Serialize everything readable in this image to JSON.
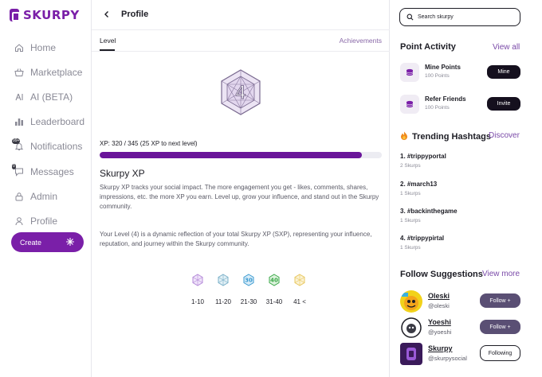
{
  "app": {
    "name": "SKURPY"
  },
  "sidebar": {
    "items": [
      {
        "label": "Home",
        "icon": "home-icon"
      },
      {
        "label": "Marketplace",
        "icon": "basket-icon"
      },
      {
        "label": "AI (BETA)",
        "icon": "ai-icon"
      },
      {
        "label": "Leaderboard",
        "icon": "bar-chart-icon"
      },
      {
        "label": "Notifications",
        "icon": "bell-icon",
        "badge": "99+"
      },
      {
        "label": "Messages",
        "icon": "chat-icon",
        "badge": "0"
      },
      {
        "label": "Admin",
        "icon": "lock-icon"
      },
      {
        "label": "Profile",
        "icon": "user-icon"
      }
    ],
    "create_label": "Create"
  },
  "header": {
    "title": "Profile"
  },
  "tabs": {
    "level": "Level",
    "achievements": "Achievements"
  },
  "level": {
    "number": "4",
    "xp_text": "XP: 320 / 345 (25 XP to next level)",
    "xp_progress_fraction": 0.928,
    "section_title": "Skurpy XP",
    "para1": "Skurpy XP tracks your social impact. The more engagement you get - likes, comments, shares, impressions, etc. the more XP you earn. Level up, grow your influence, and stand out in the Skurpy community.",
    "para2": "Your Level (4) is a dynamic reflection of your total Skurpy XP (SXP), representing your influence, reputation, and journey within the Skurpy community.",
    "tiers": [
      {
        "label": "1-10",
        "icon_text": "",
        "color": "#b48ad8"
      },
      {
        "label": "11-20",
        "icon_text": "",
        "color": "#7ab0c8"
      },
      {
        "label": "21-30",
        "icon_text": "30",
        "color": "#3a9ad0"
      },
      {
        "label": "31-40",
        "icon_text": "40",
        "color": "#3aa848"
      },
      {
        "label": "41 <",
        "icon_text": "",
        "color": "#e8c860"
      }
    ]
  },
  "right": {
    "search_placeholder": "Search skurpy",
    "point_activity": {
      "title": "Point Activity",
      "view_all": "View all",
      "items": [
        {
          "title": "Mine Points",
          "sub": "100 Points",
          "button": "Mine"
        },
        {
          "title": "Refer Friends",
          "sub": "100 Points",
          "button": "Invite"
        }
      ]
    },
    "trending": {
      "title": "Trending Hashtags",
      "link": "Discover",
      "items": [
        {
          "tag": "1. #trippyportal",
          "count": "2 Skurps"
        },
        {
          "tag": "2. #march13",
          "count": "1 Skurps"
        },
        {
          "tag": "3. #backinthegame",
          "count": "1 Skurps"
        },
        {
          "tag": "4. #trippypirtal",
          "count": "1 Skurps"
        }
      ]
    },
    "follow": {
      "title": "Follow Suggestions",
      "link": "View more",
      "items": [
        {
          "name": "Oleski",
          "handle": "@oleski",
          "button": "Follow +"
        },
        {
          "name": "Yoeshi",
          "handle": "@yoeshi",
          "button": "Follow +"
        },
        {
          "name": "Skurpy",
          "handle": "@skurpysocial",
          "button": "Following"
        }
      ]
    }
  }
}
